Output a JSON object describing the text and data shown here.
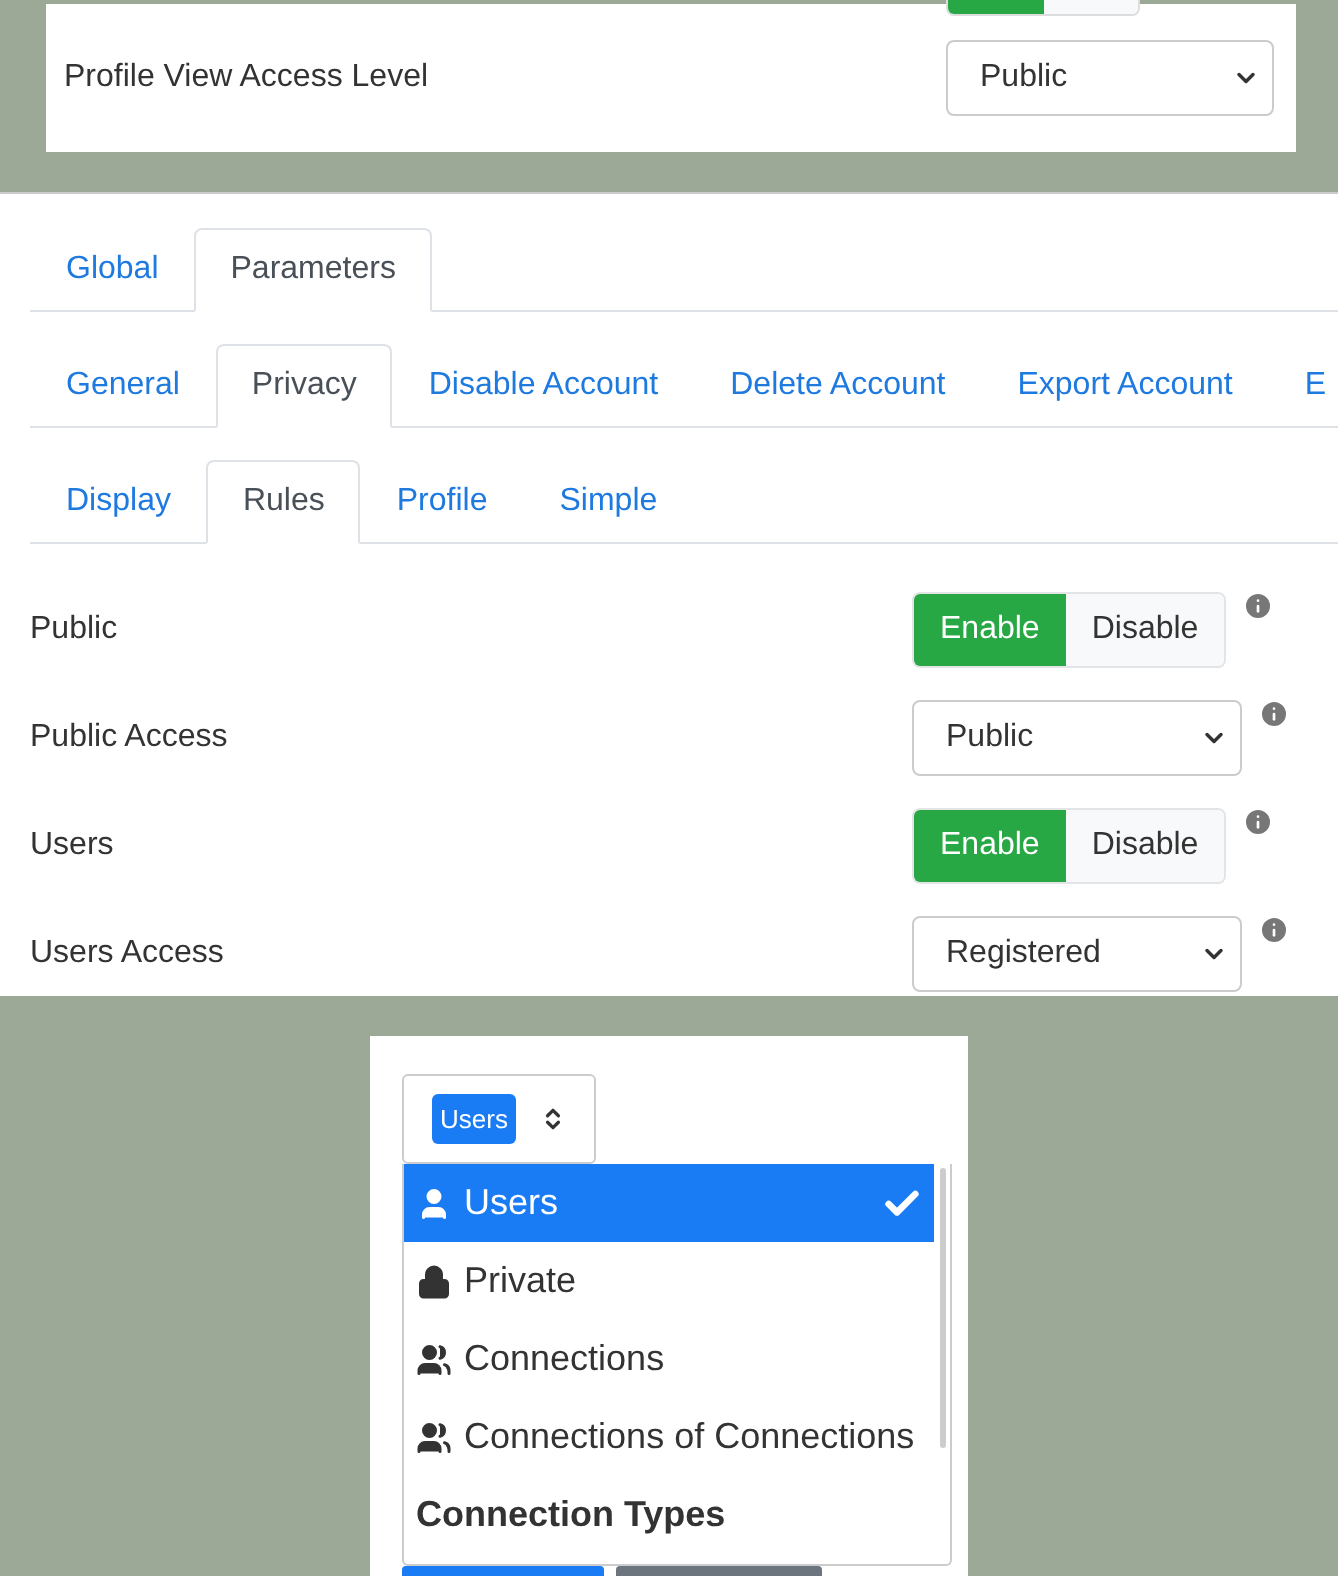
{
  "top_card": {
    "partial_toggle": {
      "enabled": true
    },
    "field": {
      "label": "Profile View Access Level",
      "value": "Public"
    }
  },
  "tab_rows": [
    [
      {
        "label": "Global",
        "selected": false
      },
      {
        "label": "Parameters",
        "selected": true
      }
    ],
    [
      {
        "label": "General",
        "selected": false
      },
      {
        "label": "Privacy",
        "selected": true
      },
      {
        "label": "Disable Account",
        "selected": false
      },
      {
        "label": "Delete Account",
        "selected": false
      },
      {
        "label": "Export Account",
        "selected": false
      },
      {
        "label": "E",
        "selected": false
      }
    ],
    [
      {
        "label": "Display",
        "selected": false
      },
      {
        "label": "Rules",
        "selected": true
      },
      {
        "label": "Profile",
        "selected": false
      },
      {
        "label": "Simple",
        "selected": false
      }
    ]
  ],
  "settings": [
    {
      "kind": "toggle",
      "label": "Public",
      "options": [
        {
          "label": "Enable",
          "selected": true
        },
        {
          "label": "Disable",
          "selected": false
        }
      ]
    },
    {
      "kind": "select",
      "label": "Public Access",
      "value": "Public"
    },
    {
      "kind": "toggle",
      "label": "Users",
      "options": [
        {
          "label": "Enable",
          "selected": true
        },
        {
          "label": "Disable",
          "selected": false
        }
      ]
    },
    {
      "kind": "select",
      "label": "Users Access",
      "value": "Registered"
    }
  ],
  "privacy_select": {
    "badge": "Users",
    "items": [
      {
        "kind": "user",
        "label": "Users",
        "selected": true
      },
      {
        "kind": "lock",
        "label": "Private",
        "selected": false
      },
      {
        "kind": "group",
        "label": "Connections",
        "selected": false
      },
      {
        "kind": "group",
        "label": "Connections of Connections",
        "selected": false
      },
      {
        "kind": "header",
        "label": "Connection Types"
      }
    ]
  },
  "buttons": [
    {
      "kind": "primary"
    },
    {
      "kind": "secondary"
    }
  ]
}
